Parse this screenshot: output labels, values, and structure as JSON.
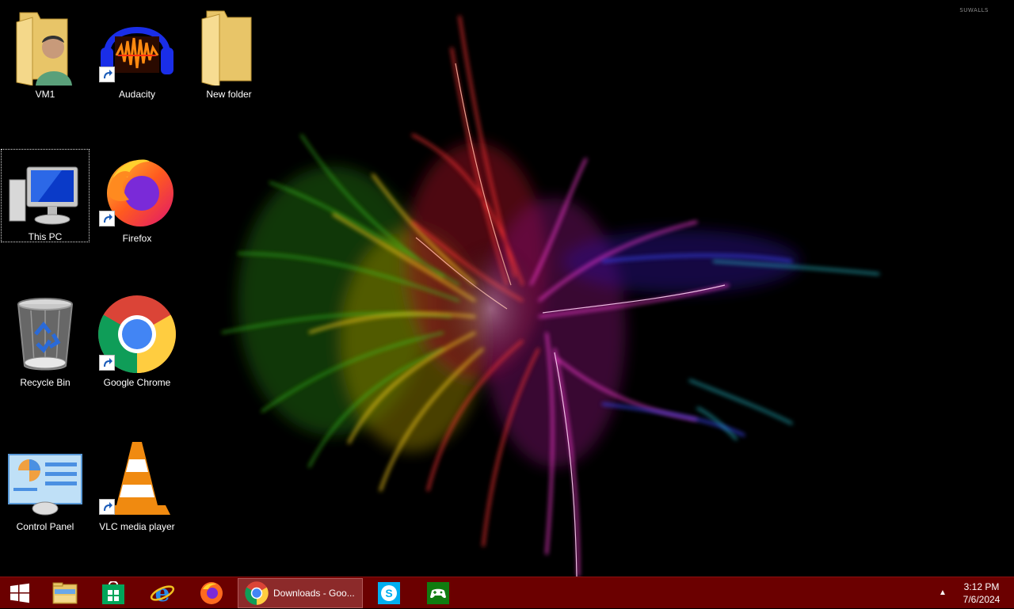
{
  "wallpaper": {
    "watermark": "SUWALLS"
  },
  "desktop": {
    "icons": [
      {
        "label": "VM1"
      },
      {
        "label": "Audacity"
      },
      {
        "label": "New folder"
      },
      {
        "label": "This PC"
      },
      {
        "label": "Firefox"
      },
      {
        "label": "Recycle Bin"
      },
      {
        "label": "Google Chrome"
      },
      {
        "label": "Control Panel"
      },
      {
        "label": "VLC media player"
      }
    ]
  },
  "taskbar": {
    "color": "#6b0000",
    "active_window_label": "Downloads - Goo...",
    "pinned": [
      "start-icon",
      "file-explorer-icon",
      "store-icon",
      "internet-explorer-icon",
      "firefox-icon",
      "chrome-icon",
      "skype-icon",
      "xbox-icon"
    ],
    "clock": {
      "time": "3:12 PM",
      "date": "7/6/2024"
    }
  }
}
